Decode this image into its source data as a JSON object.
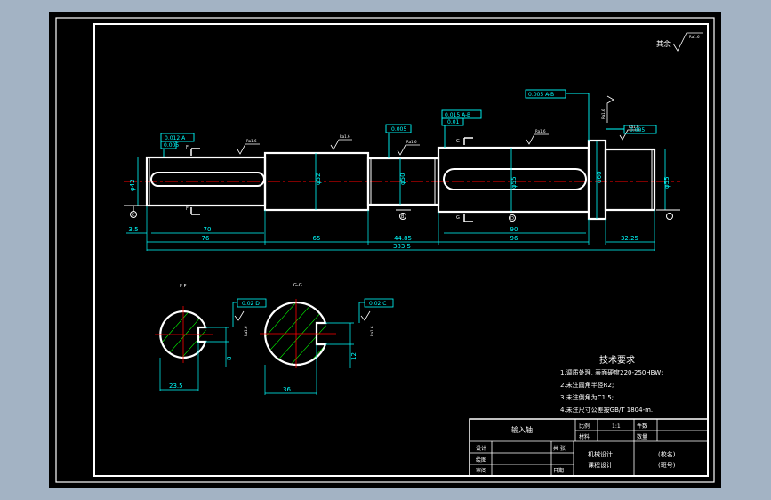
{
  "colors": {
    "app_bg": "#a3b3c4",
    "paper": "#000000",
    "outline": "#ffffff",
    "dimension": "#00ffff",
    "centerline": "#ff0000",
    "hatch": "#00ff00"
  },
  "roughness": {
    "general": "其余",
    "surface_mark": "Ra1.6",
    "upper_mark": "Ra1.6"
  },
  "tolerances": {
    "left_runout": "0.012 A",
    "left_flat": "0.005",
    "mid_flat": "0.005",
    "mid_runout": "0.015 A-B",
    "mid_flat2": "0.01",
    "right_runout": "0.005 A-B",
    "right_flat": "0.005",
    "sec_f": "0.02 D",
    "sec_g": "0.02 C"
  },
  "datums": {
    "c": "C",
    "b": "B",
    "d": "D"
  },
  "section_labels": {
    "f_top": "F",
    "f_bottom": "F",
    "g_top": "G",
    "g_bottom": "G",
    "ff": "F-F",
    "gg": "G-G"
  },
  "diameters": {
    "d1": "φ42",
    "d2": "φ52",
    "d3": "φ50",
    "d4": "φ55",
    "d5": "φ60",
    "d6": "φ55"
  },
  "dims": {
    "d35": "3.5",
    "d70": "70",
    "d76": "76",
    "d65": "65",
    "d4485": "44.85",
    "d90": "90",
    "d96": "96",
    "d3225": "32.25",
    "d3835": "383.5",
    "sec1_width": "23.5",
    "sec1_slot": "8",
    "sec2_width": "36",
    "sec2_slot": "12"
  },
  "tech": {
    "title": "技术要求",
    "lines": [
      "1.调质处理, 表面硬度220-250HBW;",
      "2.未注圆角半径R2;",
      "3.未注倒角为C1.5;",
      "4.未注尺寸公差按GB/T 1804-m."
    ]
  },
  "title_block": {
    "part_name": "输入轴",
    "ratio_label": "比例",
    "ratio_value": "1:1",
    "count_label": "件数",
    "material_label": "材料",
    "qty_label": "数量",
    "sheet_label": "共 张",
    "design_label": "设计",
    "draw_label": "绘图",
    "check_label": "审阅",
    "date_label": "日期",
    "course1": "机械设计",
    "course2": "课程设计",
    "school": "(校名)",
    "class_no": "(班号)"
  }
}
